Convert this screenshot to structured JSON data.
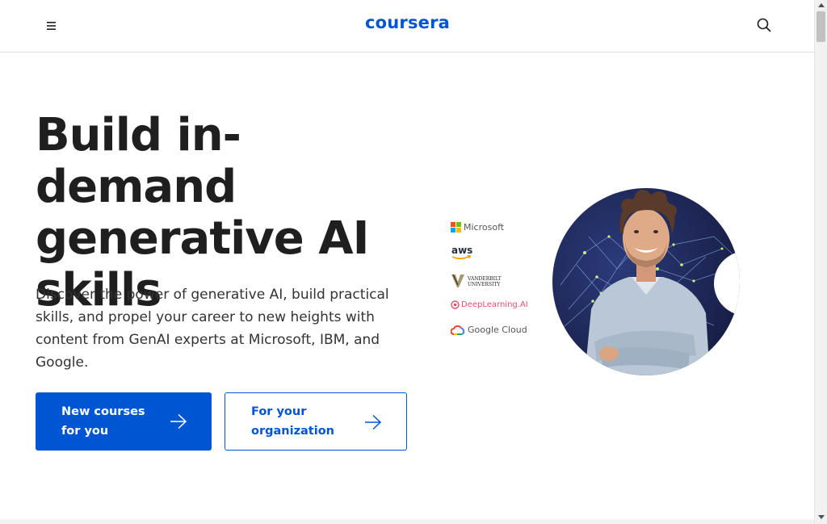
{
  "header": {
    "logo_text": "coursera",
    "menu_icon": "hamburger-icon",
    "search_icon": "search-icon"
  },
  "hero": {
    "title": "Build in-demand generative AI skills",
    "description": "Discover the power of generative AI, build practical skills, and propel your career to new heights with content from GenAI experts at Microsoft, IBM, and Google.",
    "primary_button": "New courses for you",
    "secondary_button": "For your organization"
  },
  "partners": {
    "microsoft": "Microsoft",
    "aws": "aws",
    "vanderbilt_line1": "VANDERBILT",
    "vanderbilt_line2": "UNIVERSITY",
    "deeplearning": "DeepLearning.AI",
    "google_cloud": "Google Cloud"
  },
  "colors": {
    "brand": "#0056d2",
    "text": "#1f1f1f"
  }
}
